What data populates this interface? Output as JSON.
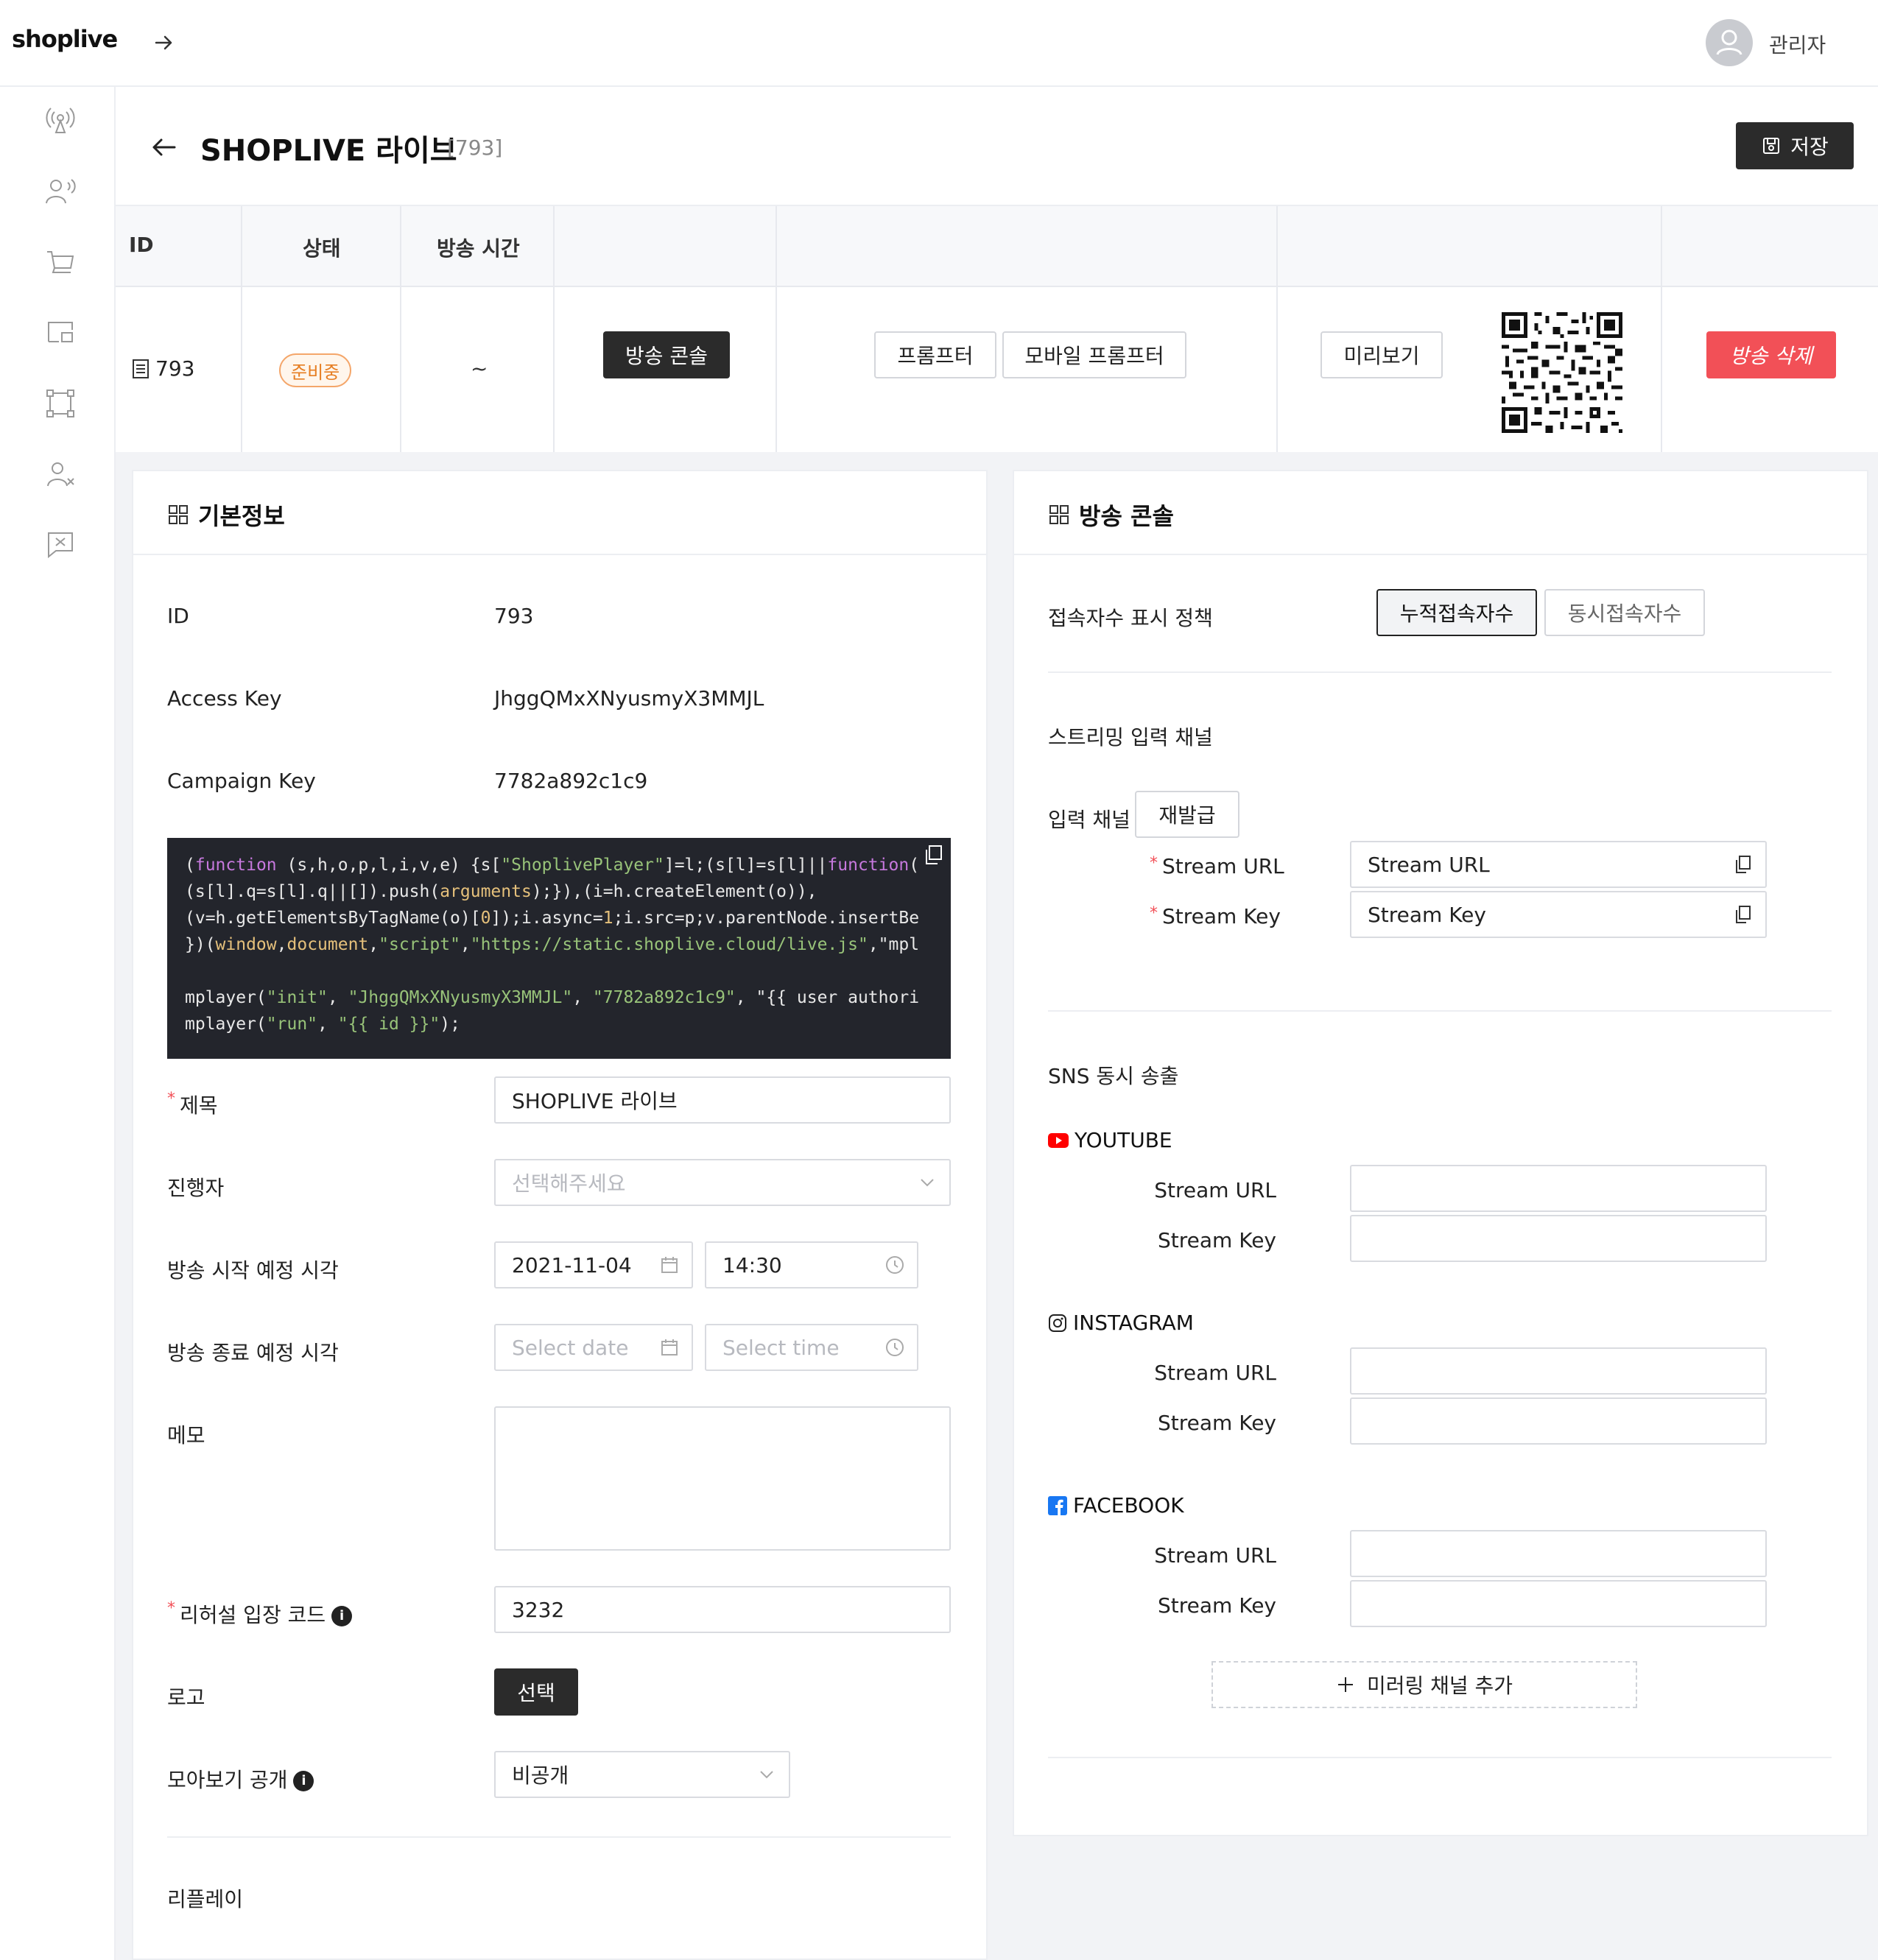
{
  "app": {
    "logo": "shoplive",
    "user_name": "관리자"
  },
  "header": {
    "title": "SHOPLIVE 라이브",
    "id_tag": "[793]",
    "save_label": "저장"
  },
  "summary": {
    "headers": {
      "id": "ID",
      "status": "상태",
      "time": "방송 시간"
    },
    "row": {
      "id": "793",
      "status": "준비중",
      "time": "~",
      "console_button": "방송 콘솔",
      "prompter_button": "프롬프터",
      "mobile_prompter_button": "모바일 프롬프터",
      "preview_button": "미리보기",
      "delete_button": "방송 삭제"
    }
  },
  "basic_info": {
    "title": "기본정보",
    "id_label": "ID",
    "id_value": "793",
    "access_key_label": "Access Key",
    "access_key_value": "JhggQMxXNyusmyX3MMJL",
    "campaign_key_label": "Campaign Key",
    "campaign_key_value": "7782a892c1c9",
    "code_lines": [
      "(function (s,h,o,p,l,i,v,e) {s[\"ShoplivePlayer\"]=l;(s[l]=s[l]||function(",
      "(s[l].q=s[l].q||[]).push(arguments);}),(i=h.createElement(o)),",
      "(v=h.getElementsByTagName(o)[0]);i.async=1;i.src=p;v.parentNode.insertBe",
      "})(window,document,\"script\",\"https://static.shoplive.cloud/live.js\",\"mpl",
      "",
      "mplayer(\"init\", \"JhggQMxXNyusmyX3MMJL\", \"7782a892c1c9\", \"{{ user authori",
      "mplayer(\"run\", \"{{ id }}\");"
    ],
    "title_label": "제목",
    "title_value": "SHOPLIVE 라이브",
    "host_label": "진행자",
    "host_placeholder": "선택해주세요",
    "start_label": "방송 시작 예정 시각",
    "start_date": "2021-11-04",
    "start_time": "14:30",
    "end_label": "방송 종료 예정 시각",
    "end_date_placeholder": "Select date",
    "end_time_placeholder": "Select time",
    "memo_label": "메모",
    "memo_value": "",
    "rehearsal_label": "리허설 입장 코드",
    "rehearsal_value": "3232",
    "logo_label": "로고",
    "logo_button": "선택",
    "browse_label": "모아보기 공개",
    "browse_value": "비공개",
    "replay_label": "리플레이"
  },
  "console": {
    "title": "방송 콘솔",
    "viewer_policy_label": "접속자수 표시 정책",
    "viewer_option_total": "누적접속자수",
    "viewer_option_concurrent": "동시접속자수",
    "streaming_section": "스트리밍 입력 채널",
    "input_channel_label": "입력 채널",
    "reissue_button": "재발급",
    "stream_url_label": "Stream URL",
    "stream_key_label": "Stream Key",
    "stream_url_value": "Stream URL",
    "stream_key_value": "Stream Key",
    "sns_section": "SNS 동시 송출",
    "youtube": "YOUTUBE",
    "instagram": "INSTAGRAM",
    "facebook": "FACEBOOK",
    "add_mirror_button": "미러링 채널 추가"
  },
  "colors": {
    "accent_dark": "#2b2b2b",
    "danger": "#f25057",
    "status_orange": "#e67e22",
    "youtube_red": "#ff0000",
    "facebook_blue": "#1877f2"
  }
}
